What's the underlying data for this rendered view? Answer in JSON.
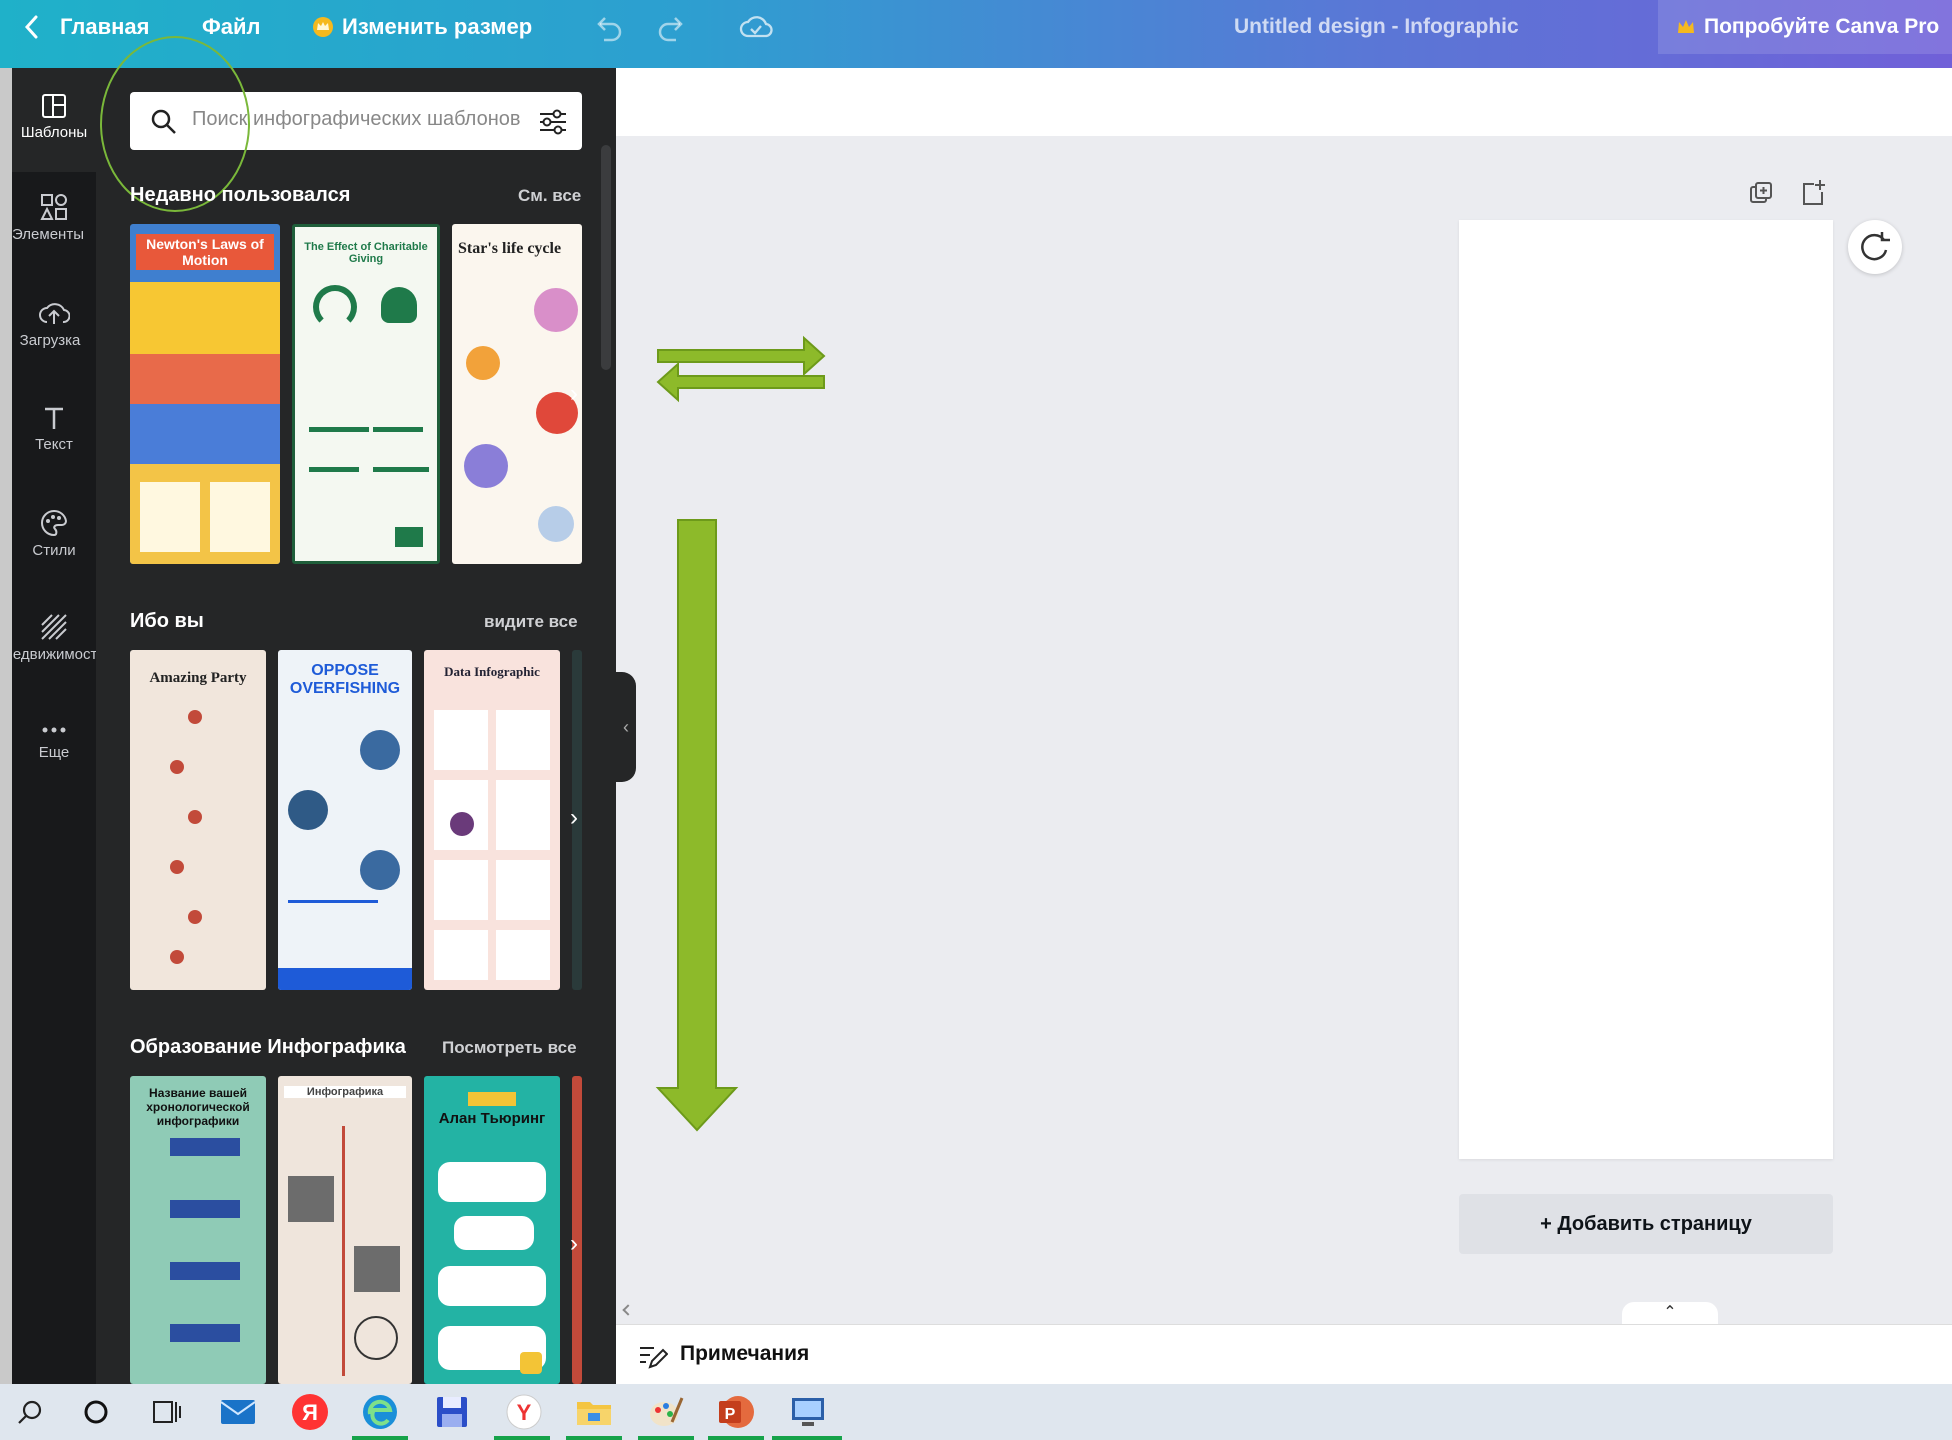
{
  "topbar": {
    "home": "Главная",
    "file": "Файл",
    "resize": "Изменить размер",
    "doc_title": "Untitled design - Infographic",
    "pro": "Попробуйте Canva Pro"
  },
  "rail": {
    "items": [
      {
        "label": "Шаблоны",
        "icon": "templates-icon"
      },
      {
        "label": "Элементы",
        "icon": "elements-icon"
      },
      {
        "label": "Загрузка",
        "icon": "upload-icon"
      },
      {
        "label": "Текст",
        "icon": "text-icon"
      },
      {
        "label": "Стили",
        "icon": "styles-icon"
      },
      {
        "label": "Недвижимость",
        "icon": "background-icon"
      },
      {
        "label": "Еще",
        "icon": "more-icon"
      }
    ]
  },
  "search": {
    "placeholder": "Поиск инфографических шаблонов"
  },
  "sections": [
    {
      "title": "Недавно пользовался",
      "link": "См. все",
      "thumbs": [
        {
          "text": "Newton's Laws of Motion"
        },
        {
          "text": "The Effect of Charitable Giving"
        },
        {
          "text": "Star's life cycle"
        }
      ]
    },
    {
      "title": "Ибо вы",
      "link": "видите все",
      "thumbs": [
        {
          "text": "Amazing Party"
        },
        {
          "text": "OPPOSE OVERFISHING"
        },
        {
          "text": "Data Infographic"
        }
      ]
    },
    {
      "title": "Образование Инфографика",
      "link": "Посмотреть все",
      "thumbs": [
        {
          "text": "Название вашей хронологической инфографики"
        },
        {
          "text": "Инфографика"
        },
        {
          "text": "Алан Тьюринг"
        }
      ]
    }
  ],
  "workspace": {
    "add_page": "+ Добавить страницу",
    "notes": "Примечания"
  },
  "colors": {
    "brand_teal": "#1fb1c9",
    "brand_purple": "#7060d8",
    "arrow_green": "#8dba2a",
    "panel_bg": "#252627"
  },
  "taskbar": {
    "icons": [
      "search-icon",
      "cortana-icon",
      "task-view-icon",
      "mail-icon",
      "yandex-icon",
      "edge-icon",
      "save-icon",
      "yandex-browser-icon",
      "explorer-icon",
      "paint-icon",
      "powerpoint-icon",
      "remote-desktop-icon"
    ]
  }
}
